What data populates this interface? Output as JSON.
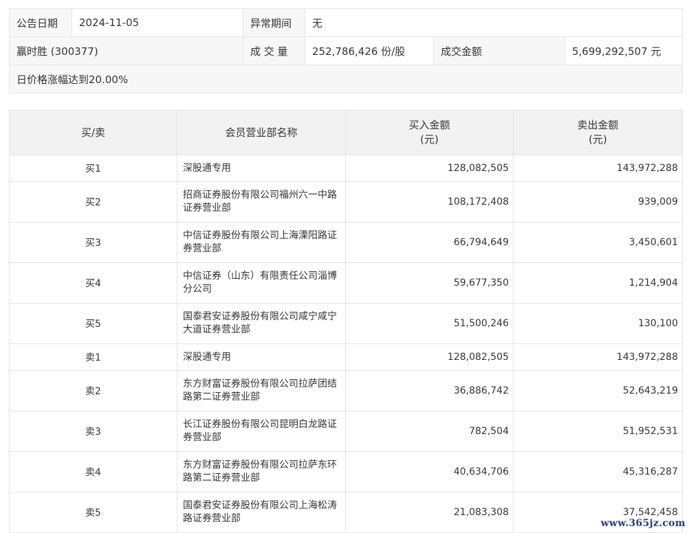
{
  "info": {
    "announce_date_label": "公告日期",
    "announce_date_value": "2024-11-05",
    "abnormal_period_label": "异常期间",
    "abnormal_period_value": "无",
    "stock_name": "赢时胜 (300377)",
    "volume_label": "成 交 量",
    "volume_value": "252,786,426 份/股",
    "turnover_label": "成交金额",
    "turnover_value": "5,699,292,507 元",
    "reason": "日价格涨幅达到20.00%"
  },
  "table": {
    "headers": {
      "side": "买/卖",
      "member": "会员营业部名称",
      "buy": "买入金额",
      "buy_unit": "(元)",
      "sell": "卖出金额",
      "sell_unit": "(元)"
    },
    "rows": [
      {
        "side": "买1",
        "name": "深股通专用",
        "buy": "128,082,505",
        "sell": "143,972,288"
      },
      {
        "side": "买2",
        "name": "招商证券股份有限公司福州六一中路证券营业部",
        "buy": "108,172,408",
        "sell": "939,009"
      },
      {
        "side": "买3",
        "name": "中信证券股份有限公司上海溧阳路证券营业部",
        "buy": "66,794,649",
        "sell": "3,450,601"
      },
      {
        "side": "买4",
        "name": "中信证券（山东）有限责任公司淄博分公司",
        "buy": "59,677,350",
        "sell": "1,214,904"
      },
      {
        "side": "买5",
        "name": "国泰君安证券股份有限公司咸宁咸宁大道证券营业部",
        "buy": "51,500,246",
        "sell": "130,100"
      },
      {
        "side": "卖1",
        "name": "深股通专用",
        "buy": "128,082,505",
        "sell": "143,972,288"
      },
      {
        "side": "卖2",
        "name": "东方财富证券股份有限公司拉萨团结路第二证券营业部",
        "buy": "36,886,742",
        "sell": "52,643,219"
      },
      {
        "side": "卖3",
        "name": "长江证券股份有限公司昆明白龙路证券营业部",
        "buy": "782,504",
        "sell": "51,952,531"
      },
      {
        "side": "卖4",
        "name": "东方财富证券股份有限公司拉萨东环路第二证券营业部",
        "buy": "40,634,706",
        "sell": "45,316,287"
      },
      {
        "side": "卖5",
        "name": "国泰君安证券股份有限公司上海松涛路证券营业部",
        "buy": "21,083,308",
        "sell": "37,542,458"
      }
    ]
  },
  "watermark": "www.365jz.com"
}
